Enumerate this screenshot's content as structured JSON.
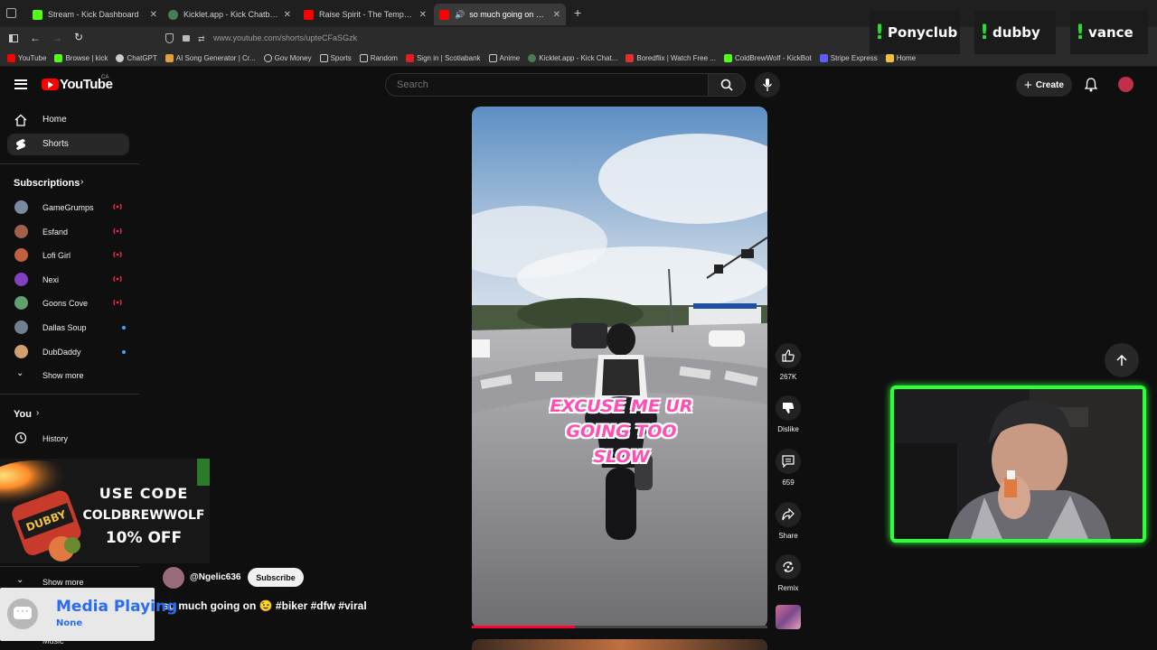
{
  "browser": {
    "tabs": [
      {
        "label": "Stream - Kick Dashboard",
        "color": "#53fc18"
      },
      {
        "label": "Kicklet.app - Kick Chatbot and C",
        "color": "#4a7a5a"
      },
      {
        "label": "Raise Spirit - The Temple - YouT",
        "color": "#ff0000"
      },
      {
        "label": "so much going on 😉 #bik",
        "color": "#ff0000"
      }
    ],
    "url": "www.youtube.com/shorts/upteCFaSGzk",
    "bookmarks": [
      {
        "label": "YouTube",
        "color": "#ff0000"
      },
      {
        "label": "Browse | kick",
        "color": "#53fc18"
      },
      {
        "label": "ChatGPT",
        "color": "#cccccc"
      },
      {
        "label": "AI Song Generator | Cr...",
        "color": "#e0a040"
      },
      {
        "label": "Gov Money",
        "color": "#cccccc"
      },
      {
        "label": "Sports",
        "color": "#cccccc"
      },
      {
        "label": "Random",
        "color": "#cccccc"
      },
      {
        "label": "Sign in | Scotiabank",
        "color": "#e02020"
      },
      {
        "label": "Anime",
        "color": "#cccccc"
      },
      {
        "label": "Kicklet.app - Kick Chat...",
        "color": "#4a7a5a"
      },
      {
        "label": "Boredflix | Watch Free ...",
        "color": "#e03030"
      },
      {
        "label": "ColdBrewWolf - KickBot",
        "color": "#53fc18"
      },
      {
        "label": "Stripe Express",
        "color": "#635bff"
      },
      {
        "label": "Home",
        "color": "#f0c040"
      }
    ]
  },
  "overlay": {
    "nametags": [
      "Ponyclub",
      "dubby",
      "vance"
    ]
  },
  "youtube": {
    "logo": "YouTube",
    "region": "CA",
    "search_placeholder": "Search",
    "create_label": "Create"
  },
  "sidebar": {
    "home": "Home",
    "shorts": "Shorts",
    "subscriptions_title": "Subscriptions",
    "subscriptions": [
      {
        "name": "GameGrumps",
        "indicator": "live",
        "color": "#7a8aa0"
      },
      {
        "name": "Esfand",
        "indicator": "live",
        "color": "#a0604a"
      },
      {
        "name": "Lofi Girl",
        "indicator": "live",
        "color": "#c06040"
      },
      {
        "name": "Nexi",
        "indicator": "live",
        "color": "#8040c0"
      },
      {
        "name": "Goons Cove",
        "indicator": "live",
        "color": "#60a070"
      },
      {
        "name": "Dallas Soup",
        "indicator": "dot",
        "color": "#708090"
      },
      {
        "name": "DubDaddy",
        "indicator": "dot",
        "color": "#d0a070"
      }
    ],
    "show_more": "Show more",
    "you_title": "You",
    "history": "History",
    "show_more_2": "Show more",
    "music": "Music"
  },
  "promo": {
    "line1": "USE CODE",
    "line2": "COLDBREWWOLF",
    "line3": "10% OFF",
    "brand": "DUBBY"
  },
  "short": {
    "caption_line1": "EXCUSE ME UR",
    "caption_line2": "GOING TOO SLOW",
    "progress": 0.35,
    "channel": "@Ngelic636",
    "subscribe_label": "Subscribe",
    "title": "so much going on 😉 #biker #dfw #viral",
    "likes": "267K",
    "dislike_label": "Dislike",
    "comments": "659",
    "share_label": "Share",
    "remix_label": "Remix"
  },
  "media_widget": {
    "title": "Media Playing",
    "subtitle": "None"
  }
}
